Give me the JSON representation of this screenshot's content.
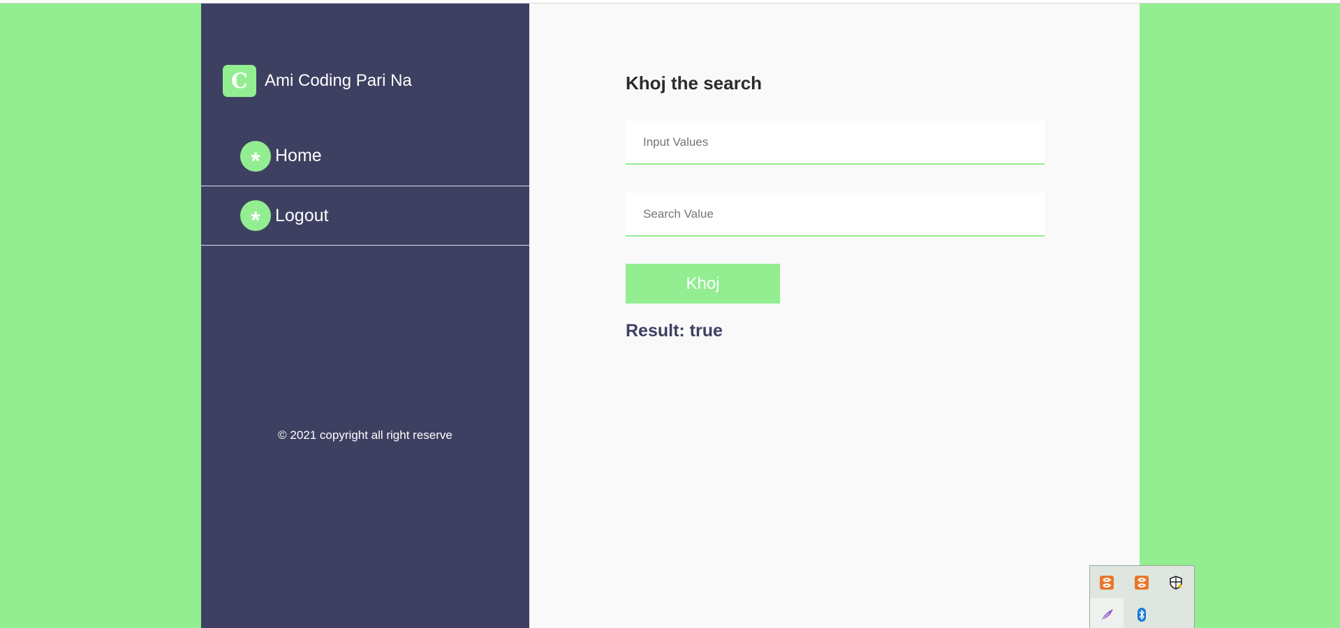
{
  "brand": {
    "logo_letter": "C",
    "name": "Ami Coding Pari Na"
  },
  "nav": {
    "items": [
      {
        "label": "Home",
        "bullet": "*"
      },
      {
        "label": "Logout",
        "bullet": "*"
      }
    ]
  },
  "footer": {
    "copyright": "© 2021 copyright all right reserve"
  },
  "main": {
    "title": "Khoj the search",
    "input_values_placeholder": "Input Values",
    "search_value_placeholder": "Search Value",
    "button_label": "Khoj",
    "result": "Result: true"
  },
  "tray": {
    "icons": [
      "xampp-icon",
      "xampp-icon",
      "security-shield-icon",
      "feather-icon",
      "bluetooth-icon"
    ]
  },
  "colors": {
    "accent": "#92ee91",
    "sidebar": "#3e4062",
    "main_bg": "#f9f9f9"
  }
}
